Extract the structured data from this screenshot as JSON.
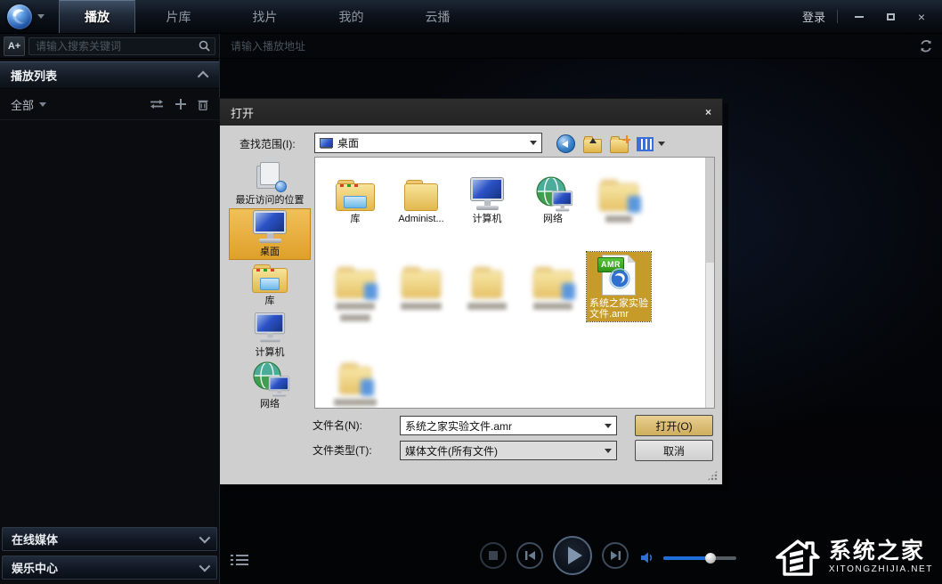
{
  "colors": {
    "accent_blue": "#1e6fd9",
    "selection_gold": "#dfa02a",
    "dialog_bg": "#cfcfcf"
  },
  "titlebar": {
    "tabs": [
      "播放",
      "片库",
      "找片",
      "我的",
      "云播"
    ],
    "active_tab": "播放",
    "login": "登录",
    "close_icon": "×"
  },
  "search": {
    "font_button": "A+",
    "search_placeholder": "请输入搜索关键词",
    "address_placeholder": "请输入播放地址"
  },
  "sidebar": {
    "playlist_header": "播放列表",
    "filter_all": "全部",
    "online_media": "在线媒体",
    "entertainment_center": "娱乐中心"
  },
  "player": {
    "volume_percent": 65
  },
  "watermark": {
    "site_name": "系统之家",
    "site_url": "XITONGZHIJIA.NET"
  },
  "dialog": {
    "title": "打开",
    "close_icon": "×",
    "look_in_label": "查找范围(I):",
    "look_in_value": "桌面",
    "places": [
      "最近访问的位置",
      "桌面",
      "库",
      "计算机",
      "网络"
    ],
    "files_row1": [
      "库",
      "Administ...",
      "计算机",
      "网络"
    ],
    "selected_file": {
      "badge": "AMR",
      "name": "系统之家实验文件.amr"
    },
    "file_name_label": "文件名(N):",
    "file_name_value": "系统之家实验文件.amr",
    "file_type_label": "文件类型(T):",
    "file_type_value": "媒体文件(所有文件)",
    "open_button": "打开(O)",
    "cancel_button": "取消"
  }
}
